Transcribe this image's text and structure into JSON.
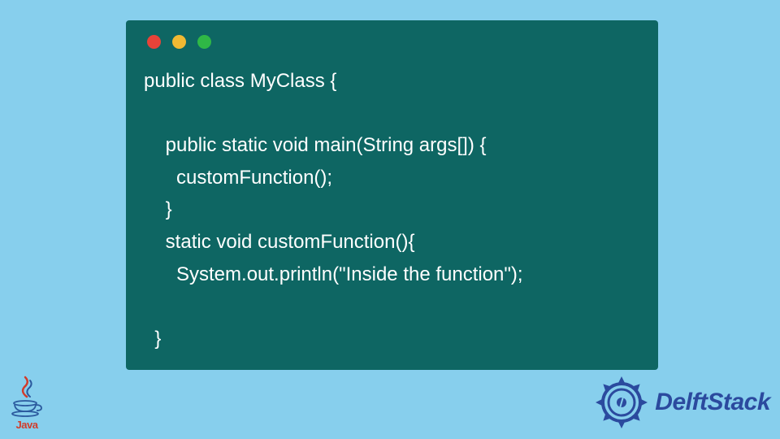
{
  "code": {
    "line1": "public class MyClass {",
    "line2": "",
    "line3": "    public static void main(String args[]) {",
    "line4": "      customFunction();",
    "line5": "    }",
    "line6": "    static void customFunction(){",
    "line7": "      System.out.println(\"Inside the function\");",
    "line8": "",
    "line9": "  }"
  },
  "brand": {
    "java_label": "Java",
    "delftstack_label": "DelftStack"
  },
  "colors": {
    "page_bg": "#87cfed",
    "window_bg": "#0e6663",
    "code_text": "#ffffff",
    "dot_red": "#e74339",
    "dot_yellow": "#f0b933",
    "dot_green": "#2fb846",
    "java_accent": "#d13c2b",
    "delftstack_accent": "#2b4a9e"
  }
}
